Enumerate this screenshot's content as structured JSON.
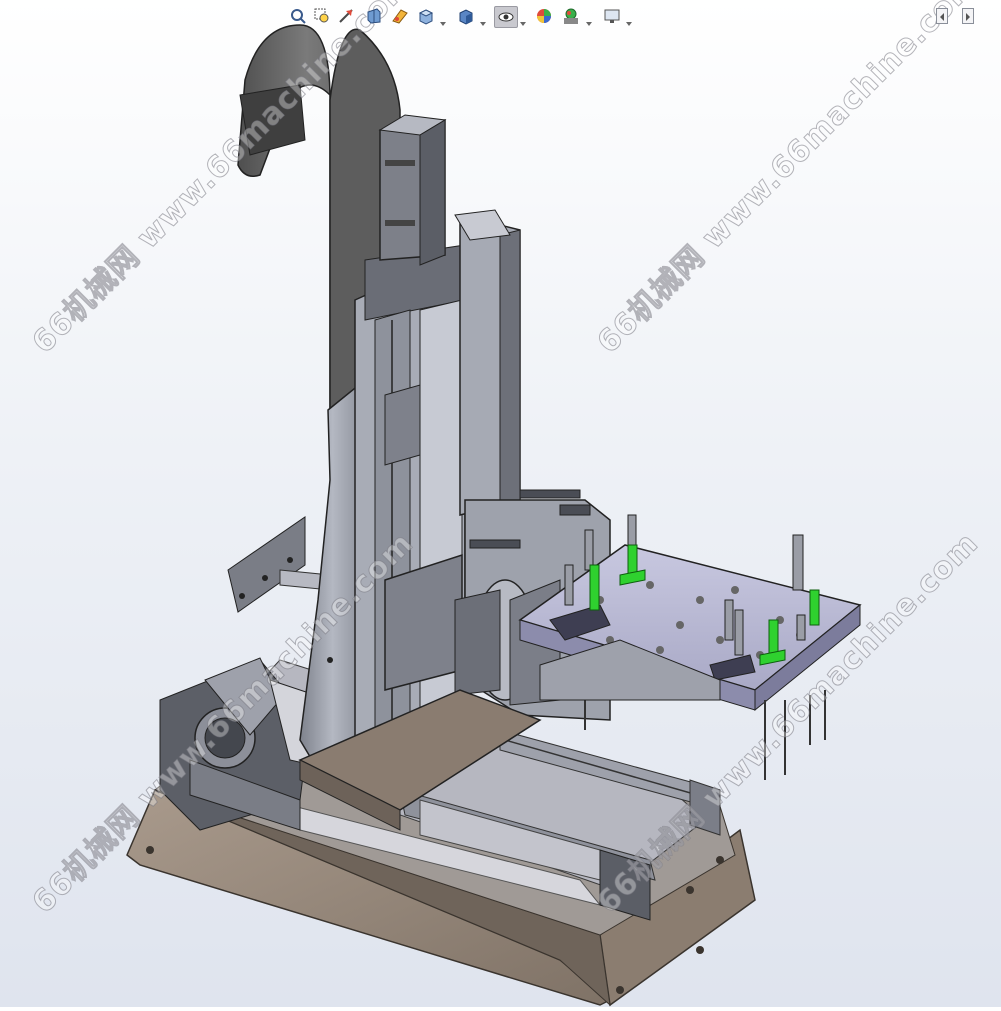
{
  "toolbar": {
    "items": [
      {
        "icon": "zoom-to-fit-icon"
      },
      {
        "icon": "zoom-to-area-icon"
      },
      {
        "icon": "previous-view-icon"
      },
      {
        "icon": "section-view-icon"
      },
      {
        "icon": "dynamic-annotation-icon"
      },
      {
        "icon": "view-orientation-icon"
      },
      {
        "icon": "display-style-icon"
      },
      {
        "icon": "hide-show-items-icon"
      },
      {
        "icon": "edit-appearance-icon"
      },
      {
        "icon": "apply-scene-icon"
      },
      {
        "icon": "view-settings-icon"
      }
    ],
    "right_icons": [
      "collapse-left-icon",
      "collapse-right-icon"
    ]
  },
  "watermark": {
    "text": "66机械网 www.66machine.com"
  },
  "colors": {
    "background_top": "#ffffff",
    "background_bottom": "#dfe4ee",
    "metal_light": "#c6c9d3",
    "metal_mid": "#9da1ad",
    "metal_dark": "#5e626c",
    "plate_purple": "#b9b9d6",
    "cable_chain": "#6b6b6b",
    "accent_green": "#2fd12f",
    "base_brown": "#9a8a7c"
  }
}
